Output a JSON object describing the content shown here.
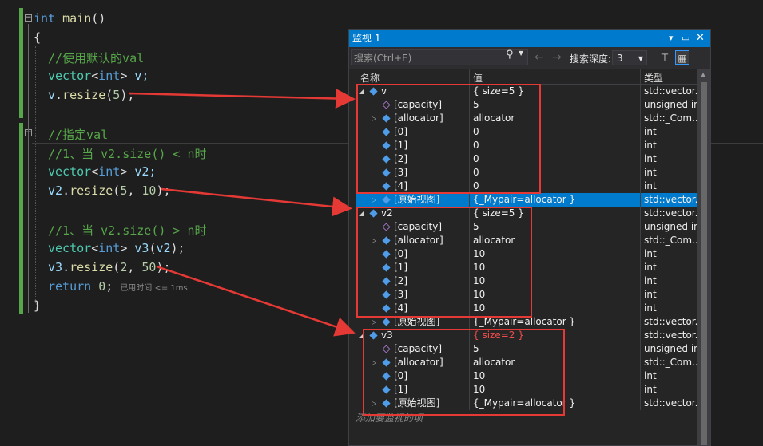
{
  "code": {
    "l1": {
      "kw": "int",
      "fn": "main",
      "rest": "()"
    },
    "l2": "{",
    "l3": "//使用默认的val",
    "l4": {
      "t": "vector",
      "lt": "<",
      "kw": "int",
      "gt": ">",
      "id": " v;"
    },
    "l5": {
      "id": "v",
      "dot": ".",
      "fn": "resize",
      "p": "(",
      "n": "5",
      "e": ");"
    },
    "l6": "//指定val",
    "l7": "//1、当 v2.size() < n时",
    "l8": {
      "t": "vector",
      "lt": "<",
      "kw": "int",
      "gt": ">",
      "id": " v2;"
    },
    "l9": {
      "id": "v2",
      "dot": ".",
      "fn": "resize",
      "p": "(",
      "n1": "5",
      "c": ", ",
      "n2": "10",
      "e": ");"
    },
    "l10": "//1、当 v2.size() > n时",
    "l11": {
      "t": "vector",
      "lt": "<",
      "kw": "int",
      "gt": ">",
      "id": " v3",
      "p": "(",
      "a": "v2",
      "e": ");"
    },
    "l12": {
      "id": "v3",
      "dot": ".",
      "fn": "resize",
      "p": "(",
      "n1": "2",
      "c": ", ",
      "n2": "50",
      "e": ");"
    },
    "l13": {
      "kw": "return",
      "sp": " ",
      "n": "0",
      "e": ";",
      "hint": "已用时间 <= 1ms"
    },
    "l14": "}"
  },
  "watch": {
    "title": "监视 1",
    "search_placeholder": "搜索(Ctrl+E)",
    "depth_label": "搜索深度:",
    "depth_value": "3",
    "col_name": "名称",
    "col_value": "值",
    "col_type": "类型",
    "add_item": "添加要监视的项",
    "rows": [
      {
        "n": "v",
        "v": "{ size=5 }",
        "t": "std::vector..."
      },
      {
        "n": "[capacity]",
        "v": "5",
        "t": "unsigned int"
      },
      {
        "n": "[allocator]",
        "v": "allocator",
        "t": "std::_Com..."
      },
      {
        "n": "[0]",
        "v": "0",
        "t": "int"
      },
      {
        "n": "[1]",
        "v": "0",
        "t": "int"
      },
      {
        "n": "[2]",
        "v": "0",
        "t": "int"
      },
      {
        "n": "[3]",
        "v": "0",
        "t": "int"
      },
      {
        "n": "[4]",
        "v": "0",
        "t": "int"
      },
      {
        "n": "[原始视图]",
        "v": "{_Mypair=allocator }",
        "t": "std::vector..."
      },
      {
        "n": "v2",
        "v": "{ size=5 }",
        "t": "std::vector..."
      },
      {
        "n": "[capacity]",
        "v": "5",
        "t": "unsigned int"
      },
      {
        "n": "[allocator]",
        "v": "allocator",
        "t": "std::_Com..."
      },
      {
        "n": "[0]",
        "v": "10",
        "t": "int"
      },
      {
        "n": "[1]",
        "v": "10",
        "t": "int"
      },
      {
        "n": "[2]",
        "v": "10",
        "t": "int"
      },
      {
        "n": "[3]",
        "v": "10",
        "t": "int"
      },
      {
        "n": "[4]",
        "v": "10",
        "t": "int"
      },
      {
        "n": "[原始视图]",
        "v": "{_Mypair=allocator }",
        "t": "std::vector..."
      },
      {
        "n": "v3",
        "v": "{ size=2 }",
        "t": "std::vector..."
      },
      {
        "n": "[capacity]",
        "v": "5",
        "t": "unsigned int"
      },
      {
        "n": "[allocator]",
        "v": "allocator",
        "t": "std::_Com..."
      },
      {
        "n": "[0]",
        "v": "10",
        "t": "int"
      },
      {
        "n": "[1]",
        "v": "10",
        "t": "int"
      },
      {
        "n": "[原始视图]",
        "v": "{_Mypair=allocator }",
        "t": "std::vector..."
      }
    ]
  }
}
